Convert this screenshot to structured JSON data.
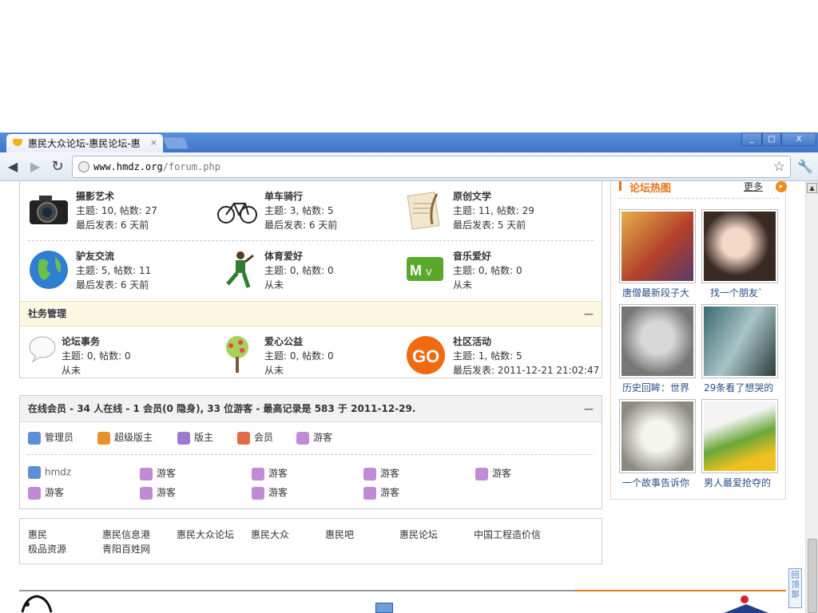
{
  "browser": {
    "tab_title": "惠民大众论坛-惠民论坛-惠",
    "tab_close": "×",
    "url_host": "www.hmdz.org",
    "url_path": "/forum.php",
    "win_min": "_",
    "win_max": "□",
    "win_close": "X"
  },
  "forums_top": [
    {
      "name": "摄影艺术",
      "stats": "主题: 10, 帖数: 27",
      "last": "最后发表: 6 天前"
    },
    {
      "name": "单车骑行",
      "stats": "主题: 3, 帖数: 5",
      "last": "最后发表: 6 天前"
    },
    {
      "name": "原创文学",
      "stats": "主题: 11, 帖数: 29",
      "last": "最后发表: 5 天前"
    },
    {
      "name": "驴友交流",
      "stats": "主题: 5, 帖数: 11",
      "last": "最后发表: 6 天前"
    },
    {
      "name": "体育爱好",
      "stats": "主题: 0, 帖数: 0",
      "last": "从未"
    },
    {
      "name": "音乐爱好",
      "stats": "主题: 0, 帖数: 0",
      "last": "从未"
    }
  ],
  "category": {
    "title": "社务管理",
    "collapse": "—"
  },
  "forums_admin": [
    {
      "name": "论坛事务",
      "stats": "主题: 0, 帖数: 0",
      "last": "从未"
    },
    {
      "name": "爱心公益",
      "stats": "主题: 0, 帖数: 0",
      "last": "从未"
    },
    {
      "name": "社区活动",
      "stats": "主题: 1, 帖数: 5",
      "last": "最后发表: 2011-12-21 21:02:47"
    }
  ],
  "online": {
    "header": "在线会员 - 34 人在线 - 1 会员(0 隐身), 33 位游客 - 最高记录是 583 于 2011-12-29.",
    "collapse": "—",
    "legend": [
      "管理员",
      "超级版主",
      "版主",
      "会员",
      "游客"
    ],
    "users": [
      "hmdz",
      "游客",
      "游客",
      "游客",
      "游客",
      "游客",
      "游客",
      "游客",
      "游客"
    ]
  },
  "links": [
    "惠民",
    "惠民信息港",
    "惠民大众论坛",
    "惠民大众",
    "惠民吧",
    "惠民论坛",
    "中国工程造价信",
    "极品资源",
    "青阳百姓网"
  ],
  "sidebar": {
    "title": "论坛热图",
    "more": "更多",
    "more_icon": "▸",
    "captions": [
      "唐僧最新段子大",
      "找一个朋友`",
      "历史回眸：世界",
      "29条看了想哭的",
      "一个故事告诉你",
      "男人最爱抢夺的"
    ]
  },
  "backtop": "回顶部",
  "icons": {
    "scroll_up": "▲",
    "star": "☆",
    "wrench": "🔧",
    "back": "◀",
    "forward": "▶",
    "reload": "↻"
  }
}
